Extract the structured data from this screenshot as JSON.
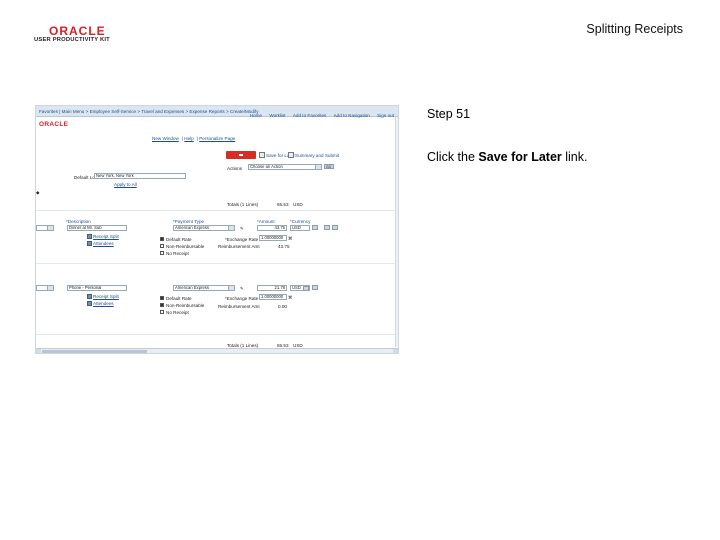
{
  "logo": {
    "wordmark": "ORACLE",
    "subtitle": "USER PRODUCTIVITY KIT"
  },
  "doc_title": "Splitting Receipts",
  "step": "Step 51",
  "instruction": {
    "before": "Click the ",
    "link": "Save for Later",
    "after": " link."
  },
  "screenshot": {
    "breadcrumbs": "Favorites  |  Main Menu  >  Employee Self-Service  >  Travel and Expenses  >  Expense Reports  >  Create/Modify",
    "nav_links": [
      "Home",
      "Worklist",
      "Add to Favorites",
      "Add to Navigation",
      "Sign out"
    ],
    "brand": "ORACLE",
    "sub_links": [
      "New Window",
      "Help",
      "Personalize Page"
    ],
    "save_for_later": "Save for Later",
    "summary_and_submit": "Summary and Submit",
    "actions_label": "Actions",
    "actions_value": "Choose an Action",
    "go_label": "GO",
    "default_location_label": "Default Location",
    "default_location_value": "New York, New York",
    "apply_to_all": "Apply to All",
    "total_1": "Totals (1 Lines)",
    "total_amount_1": "65.53",
    "total_currency_1": "USD",
    "headers": {
      "description": "*Description",
      "payment_type": "*Payment Type",
      "amount": "*Amount",
      "currency": "*Currency"
    },
    "line1": {
      "description": "Dinner at Mr. Sub",
      "payment_type": "American Express",
      "amount": "43.75",
      "currency": "USD",
      "receipt_split": "Receipt Split",
      "attendees": "Attendees",
      "default_rate": "Default Rate",
      "non_reimbursable": "Non-Reimbursable",
      "no_receipt": "No Receipt",
      "exchange_rate_label": "*Exchange Rate",
      "exchange_rate_value": "1.00000000",
      "reimb_amount_label": "Reimbursement Amt",
      "reimb_amount_value": "43.75"
    },
    "line2": {
      "description": "Phone - Personal",
      "payment_type": "American Express",
      "amount": "21.78",
      "currency": "USD",
      "receipt_split": "Receipt Split",
      "attendees": "Attendees",
      "default_rate": "Default Rate",
      "non_reimbursable": "Non-Reimbursable",
      "no_receipt": "No Receipt",
      "exchange_rate_label": "*Exchange Rate",
      "exchange_rate_value": "1.00000000",
      "reimb_amount_label": "Reimbursement Amt",
      "reimb_amount_value": "0.00"
    },
    "total_2": "Totals (1 Lines)",
    "total_amount_2": "65.53",
    "total_currency_2": "USD"
  }
}
